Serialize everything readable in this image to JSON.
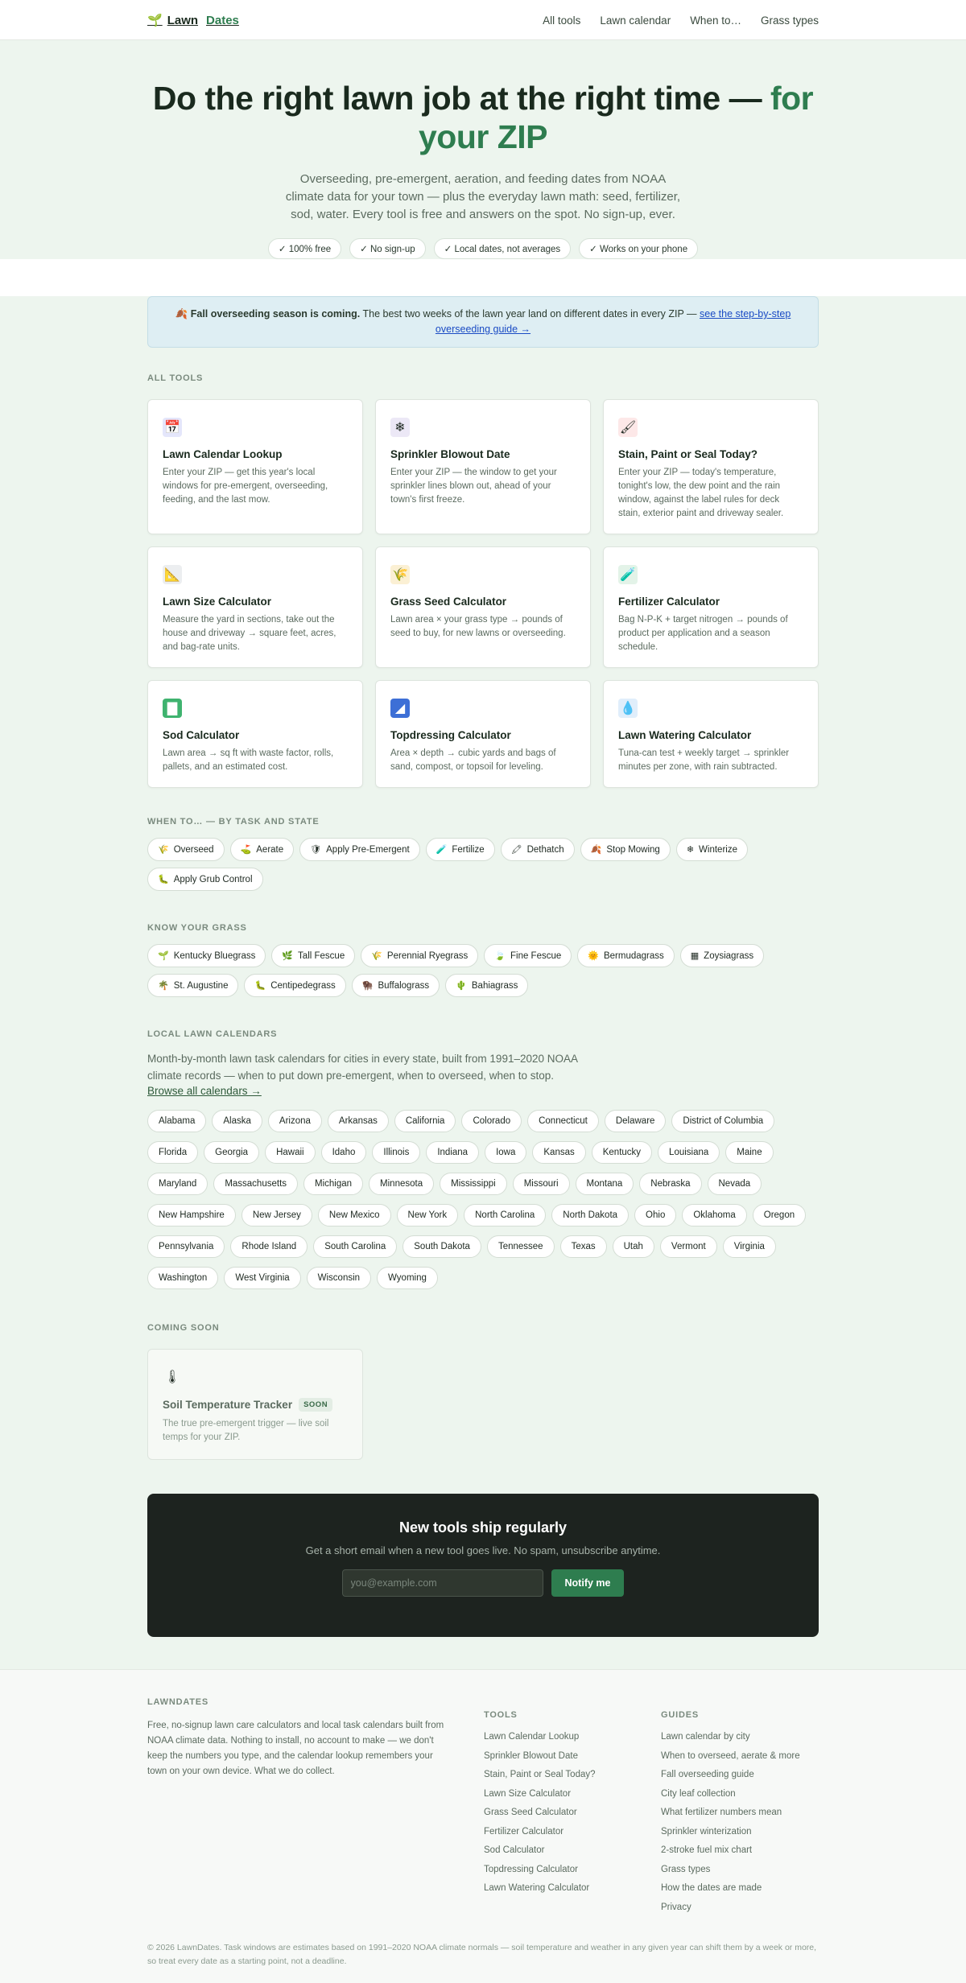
{
  "header": {
    "logo_icon": "🌱",
    "logo_name": "Lawn",
    "logo_accent": "Dates",
    "nav": [
      "All tools",
      "Lawn calendar",
      "When to…",
      "Grass types"
    ]
  },
  "hero": {
    "title_main": "Do the right lawn job at the right time —",
    "title_accent": "for your ZIP",
    "subtitle": "Overseeding, pre-emergent, aeration, and feeding dates from NOAA climate data for your town — plus the everyday lawn math: seed, fertilizer, sod, water. Every tool is free and answers on the spot. No sign-up, ever.",
    "checks": [
      "✓ 100% free",
      "✓ No sign-up",
      "✓ Local dates, not averages",
      "✓ Works on your phone"
    ]
  },
  "banner": {
    "icon": "🍂",
    "bold": "Fall overseeding season is coming.",
    "text": "The best two weeks of the lawn year land on different dates in every ZIP —",
    "link": "see the step-by-step overseeding guide →"
  },
  "tools": {
    "title": "ALL TOOLS",
    "items": [
      {
        "icon": "📅",
        "title": "Lawn Calendar Lookup",
        "desc": "Enter your ZIP — get this year's local windows for pre-emergent, overseeding, feeding, and the last mow."
      },
      {
        "icon": "❄",
        "title": "Sprinkler Blowout Date",
        "desc": "Enter your ZIP — the window to get your sprinkler lines blown out, ahead of your town's first freeze."
      },
      {
        "icon": "🖌",
        "title": "Stain, Paint or Seal Today?",
        "desc": "Enter your ZIP — today's temperature, tonight's low, the dew point and the rain window, against the label rules for deck stain, exterior paint and driveway sealer."
      },
      {
        "icon": "📐",
        "title": "Lawn Size Calculator",
        "desc": "Measure the yard in sections, take out the house and driveway → square feet, acres, and bag-rate units."
      },
      {
        "icon": "🌾",
        "title": "Grass Seed Calculator",
        "desc": "Lawn area × your grass type → pounds of seed to buy, for new lawns or overseeding."
      },
      {
        "icon": "🧪",
        "title": "Fertilizer Calculator",
        "desc": "Bag N-P-K + target nitrogen → pounds of product per application and a season schedule."
      },
      {
        "icon": "▇",
        "title": "Sod Calculator",
        "desc": "Lawn area → sq ft with waste factor, rolls, pallets, and an estimated cost."
      },
      {
        "icon": "◢",
        "title": "Topdressing Calculator",
        "desc": "Area × depth → cubic yards and bags of sand, compost, or topsoil for leveling."
      },
      {
        "icon": "💧",
        "title": "Lawn Watering Calculator",
        "desc": "Tuna-can test + weekly target → sprinkler minutes per zone, with rain subtracted."
      }
    ]
  },
  "when_to": {
    "title": "WHEN TO… — BY TASK AND STATE",
    "items": [
      {
        "icon": "🌾",
        "label": "Overseed"
      },
      {
        "icon": "⛳",
        "label": "Aerate"
      },
      {
        "icon": "🛡",
        "label": "Apply Pre-Emergent"
      },
      {
        "icon": "🧪",
        "label": "Fertilize"
      },
      {
        "icon": "🖍",
        "label": "Dethatch"
      },
      {
        "icon": "🍂",
        "label": "Stop Mowing"
      },
      {
        "icon": "❄",
        "label": "Winterize"
      },
      {
        "icon": "🐛",
        "label": "Apply Grub Control"
      }
    ]
  },
  "grass": {
    "title": "KNOW YOUR GRASS",
    "items": [
      {
        "icon": "🌱",
        "label": "Kentucky Bluegrass"
      },
      {
        "icon": "🌿",
        "label": "Tall Fescue"
      },
      {
        "icon": "🌾",
        "label": "Perennial Ryegrass"
      },
      {
        "icon": "🍃",
        "label": "Fine Fescue"
      },
      {
        "icon": "🌞",
        "label": "Bermudagrass"
      },
      {
        "icon": "▦",
        "label": "Zoysiagrass"
      },
      {
        "icon": "🌴",
        "label": "St. Augustine"
      },
      {
        "icon": "🐛",
        "label": "Centipedegrass"
      },
      {
        "icon": "🦬",
        "label": "Buffalograss"
      },
      {
        "icon": "🌵",
        "label": "Bahiagrass"
      }
    ]
  },
  "local": {
    "title": "LOCAL LAWN CALENDARS",
    "desc": "Month-by-month lawn task calendars for cities in every state, built from 1991–2020 NOAA climate records — when to put down pre-emergent, when to overseed, when to stop.",
    "link": "Browse all calendars →",
    "states": [
      "Alabama",
      "Alaska",
      "Arizona",
      "Arkansas",
      "California",
      "Colorado",
      "Connecticut",
      "Delaware",
      "District of Columbia",
      "Florida",
      "Georgia",
      "Hawaii",
      "Idaho",
      "Illinois",
      "Indiana",
      "Iowa",
      "Kansas",
      "Kentucky",
      "Louisiana",
      "Maine",
      "Maryland",
      "Massachusetts",
      "Michigan",
      "Minnesota",
      "Mississippi",
      "Missouri",
      "Montana",
      "Nebraska",
      "Nevada",
      "New Hampshire",
      "New Jersey",
      "New Mexico",
      "New York",
      "North Carolina",
      "North Dakota",
      "Ohio",
      "Oklahoma",
      "Oregon",
      "Pennsylvania",
      "Rhode Island",
      "South Carolina",
      "South Dakota",
      "Tennessee",
      "Texas",
      "Utah",
      "Vermont",
      "Virginia",
      "Washington",
      "West Virginia",
      "Wisconsin",
      "Wyoming"
    ]
  },
  "coming_soon": {
    "title": "COMING SOON",
    "card": {
      "icon": "🌡",
      "title": "Soil Temperature Tracker",
      "badge": "SOON",
      "desc": "The true pre-emergent trigger — live soil temps for your ZIP."
    }
  },
  "newsletter": {
    "title": "New tools ship regularly",
    "subtitle": "Get a short email when a new tool goes live. No spam, unsubscribe anytime.",
    "placeholder": "you@example.com",
    "button": "Notify me"
  },
  "footer": {
    "about_heading": "LAWNDATES",
    "about_text": "Free, no-signup lawn care calculators and local task calendars built from NOAA climate data. Nothing to install, no account to make — we don't keep the numbers you type, and the calendar lookup remembers your town on your own device. What we do collect.",
    "tools_heading": "TOOLS",
    "tools": [
      "Lawn Calendar Lookup",
      "Sprinkler Blowout Date",
      "Stain, Paint or Seal Today?",
      "Lawn Size Calculator",
      "Grass Seed Calculator",
      "Fertilizer Calculator",
      "Sod Calculator",
      "Topdressing Calculator",
      "Lawn Watering Calculator"
    ],
    "guides_heading": "GUIDES",
    "guides": [
      "Lawn calendar by city",
      "When to overseed, aerate & more",
      "Fall overseeding guide",
      "City leaf collection",
      "What fertilizer numbers mean",
      "Sprinkler winterization",
      "2-stroke fuel mix chart",
      "Grass types",
      "How the dates are made",
      "Privacy"
    ],
    "bottom": "© 2026 LawnDates. Task windows are estimates based on 1991–2020 NOAA climate normals — soil temperature and weather in any given year can shift them by a week or more, so treat every date as a starting point, not a deadline."
  }
}
